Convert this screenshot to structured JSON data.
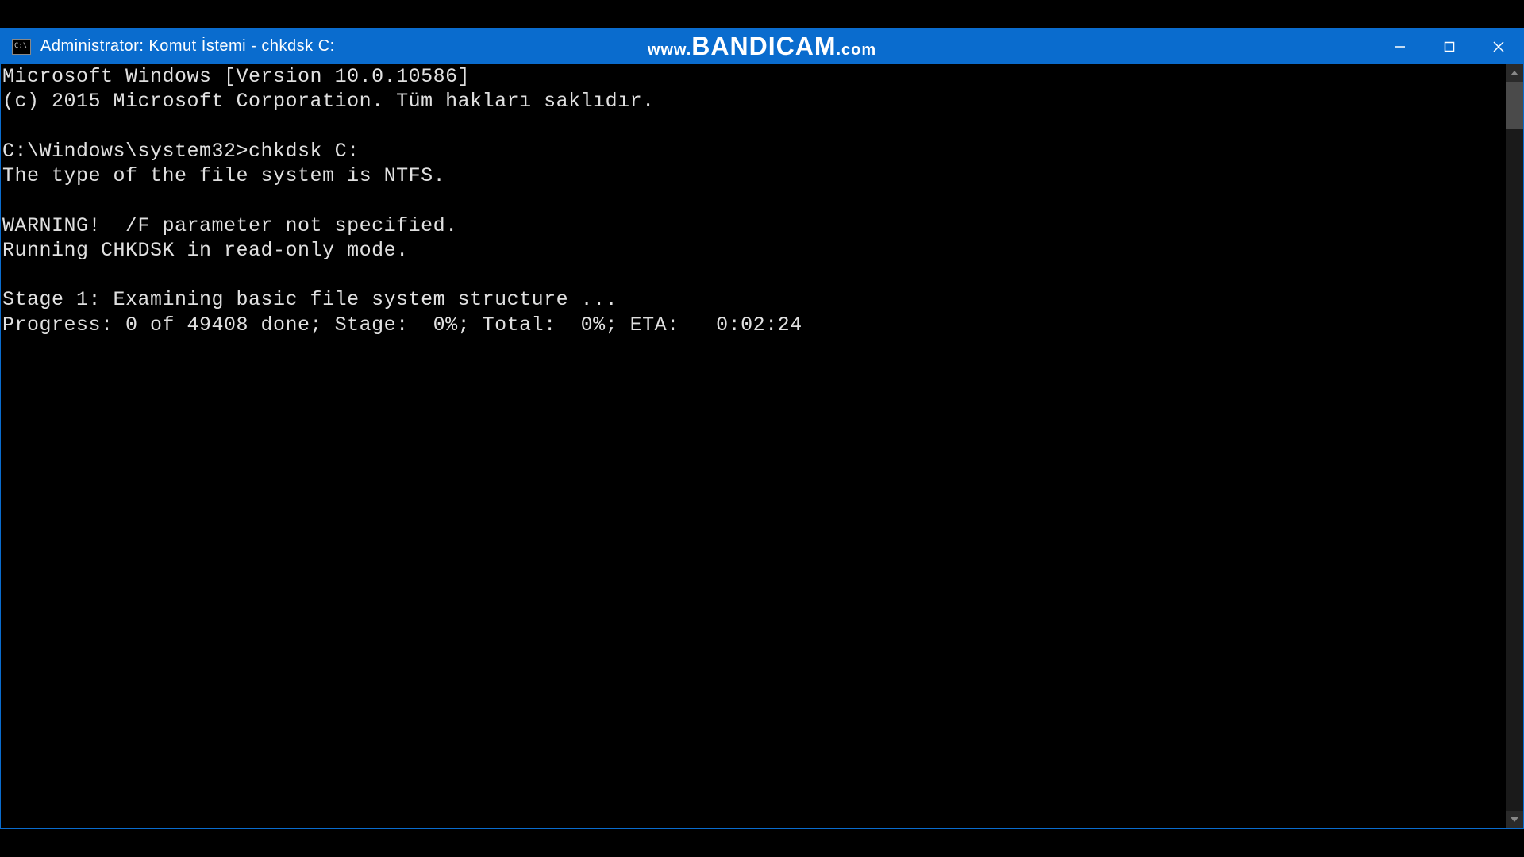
{
  "titlebar": {
    "icon_text": "C:\\",
    "title": "Administrator: Komut İstemi - chkdsk  C:"
  },
  "watermark": {
    "www": "www.",
    "brand": "BANDICAM",
    "dotcom": ".com"
  },
  "console": {
    "line1": "Microsoft Windows [Version 10.0.10586]",
    "line2": "(c) 2015 Microsoft Corporation. Tüm hakları saklıdır.",
    "blank1": "",
    "prompt": "C:\\Windows\\system32>chkdsk C:",
    "fs_line": "The type of the file system is NTFS.",
    "blank2": "",
    "warn1": "WARNING!  /F parameter not specified.",
    "warn2": "Running CHKDSK in read-only mode.",
    "blank3": "",
    "stage": "Stage 1: Examining basic file system structure ...",
    "progress": "Progress: 0 of 49408 done; Stage:  0%; Total:  0%; ETA:   0:02:24"
  }
}
